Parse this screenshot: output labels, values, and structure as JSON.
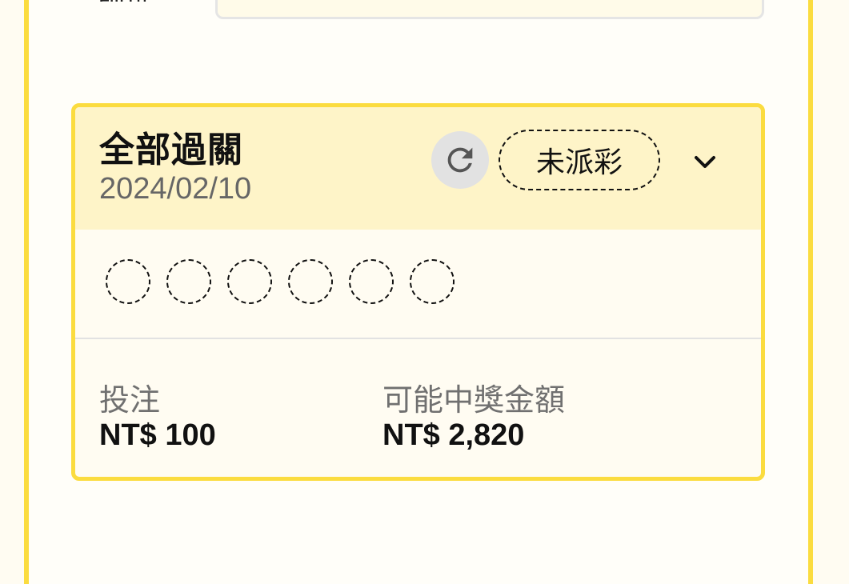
{
  "top": {
    "label": "篩選"
  },
  "card": {
    "title": "全部過關",
    "date": "2024/02/10",
    "status": "未派彩",
    "refresh_icon": "refresh-icon",
    "chevron_icon": "chevron-down-icon",
    "balls": [
      "",
      "",
      "",
      "",
      "",
      ""
    ],
    "stake_label": "投注",
    "stake_value": "NT$ 100",
    "payout_label": "可能中獎金額",
    "payout_value": "NT$ 2,820"
  },
  "colors": {
    "accent_yellow": "#fbdc3f",
    "header_bg": "#fef4c8",
    "card_bg": "#fffcf2"
  }
}
